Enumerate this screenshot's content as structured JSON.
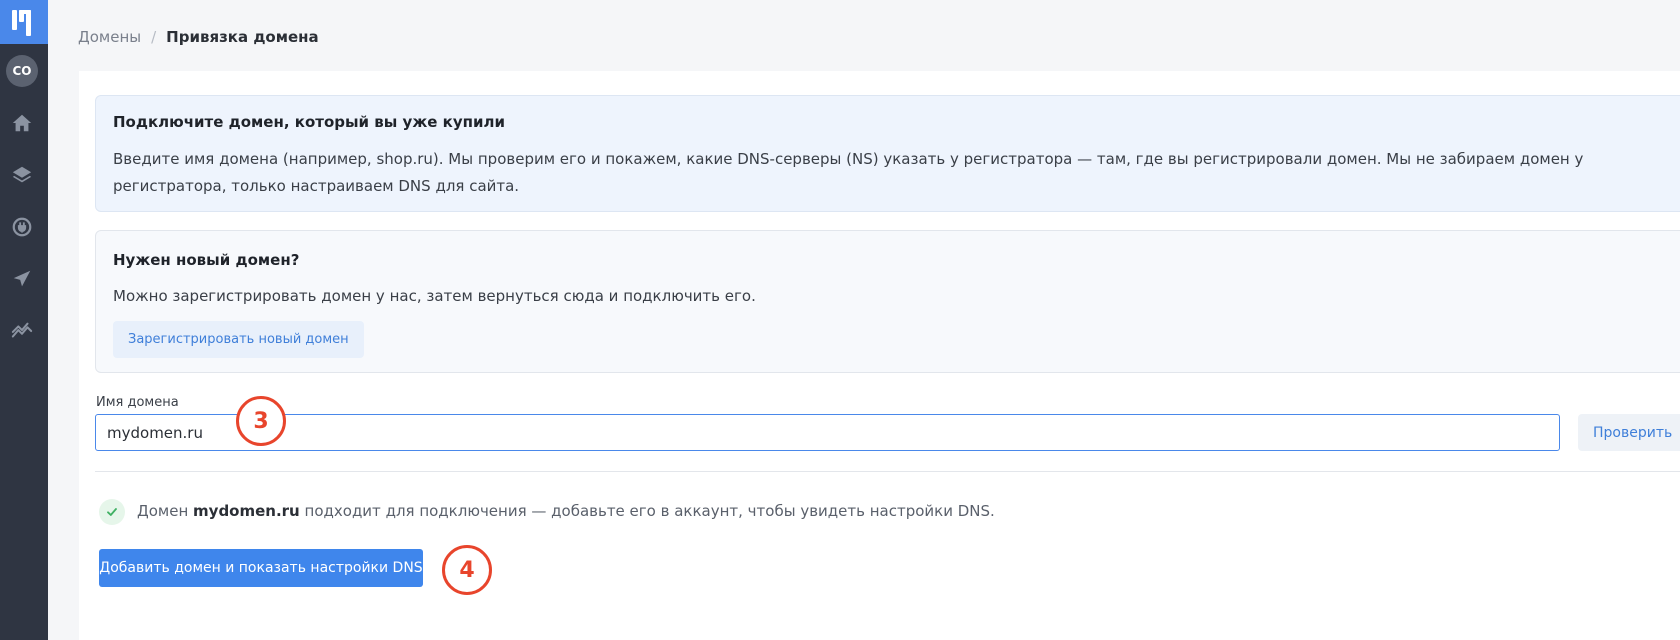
{
  "sidebar": {
    "avatar_initials": "CO",
    "icons": [
      "home-icon",
      "layers-icon",
      "plug-icon",
      "send-icon",
      "analytics-icon"
    ],
    "colors": {
      "background": "#2f3542",
      "logo": "#4a88ea"
    }
  },
  "breadcrumb": {
    "parent": "Домены",
    "separator": "/",
    "current": "Привязка домена"
  },
  "info": {
    "title": "Подключите домен, который вы уже купили",
    "text": "Введите имя домена (например, shop.ru). Мы проверим его и покажем, какие DNS-серверы (NS) указать у регистратора — там, где вы регистрировали домен. Мы не забираем домен у регистратора, только настраиваем DNS для сайта."
  },
  "new_domain": {
    "title": "Нужен новый домен?",
    "text": "Можно зарегистрировать домен у нас, затем вернуться сюда и подключить его.",
    "button_label": "Зарегистрировать новый домен"
  },
  "form": {
    "label": "Имя домена",
    "value": "mydomen.ru",
    "check_button": "Проверить"
  },
  "status": {
    "prefix": "Домен",
    "domain": "mydomen.ru",
    "suffix": "подходит для подключения — добавьте его в аккаунт, чтобы увидеть настройки DNS."
  },
  "add_button": "Добавить домен и показать настройки DNS",
  "markers": [
    "3",
    "4"
  ],
  "colors": {
    "accent": "#3f86ec",
    "marker": "#e8452c",
    "success": "#3fb163"
  }
}
